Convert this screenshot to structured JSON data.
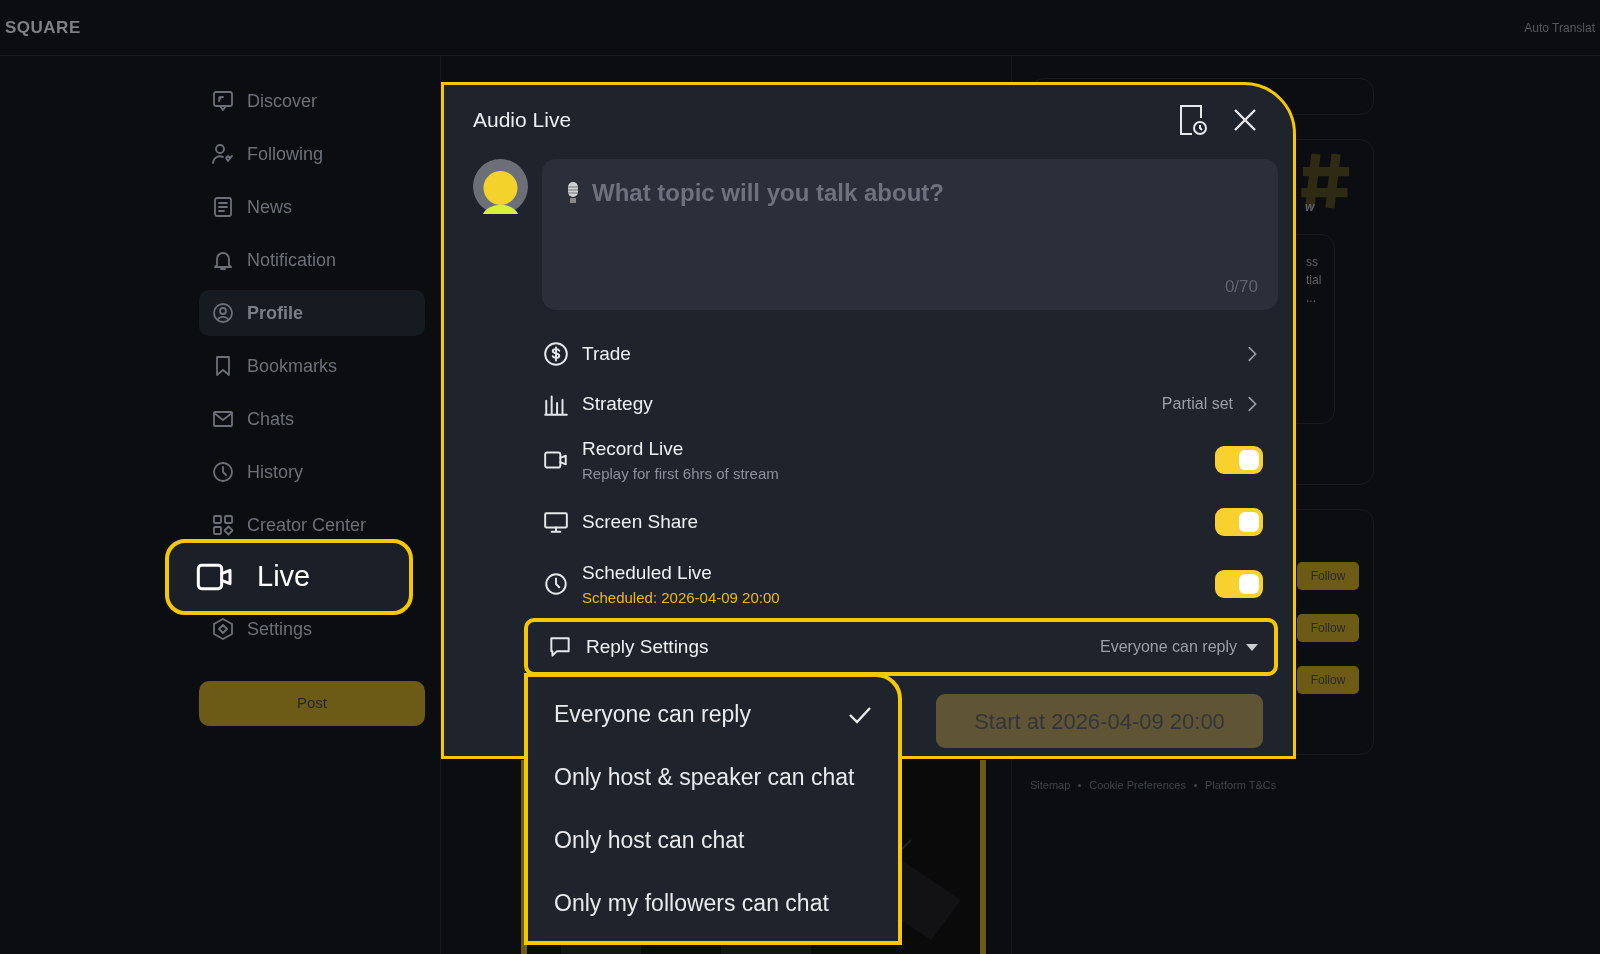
{
  "brand": "SQUARE",
  "top_right": "Auto Translat",
  "sidebar": {
    "items": [
      {
        "label": "Discover",
        "selected": false,
        "highlighted": false
      },
      {
        "label": "Following",
        "selected": false,
        "highlighted": false
      },
      {
        "label": "News",
        "selected": false,
        "highlighted": false
      },
      {
        "label": "Notification",
        "selected": false,
        "highlighted": false
      },
      {
        "label": "Profile",
        "selected": true,
        "highlighted": false
      },
      {
        "label": "Bookmarks",
        "selected": false,
        "highlighted": false
      },
      {
        "label": "Chats",
        "selected": false,
        "highlighted": false
      },
      {
        "label": "History",
        "selected": false,
        "highlighted": false
      },
      {
        "label": "Creator Center",
        "selected": false,
        "highlighted": false
      },
      {
        "label": "Live",
        "selected": false,
        "highlighted": true
      },
      {
        "label": "Settings",
        "selected": false,
        "highlighted": false
      }
    ],
    "post_button": "Post"
  },
  "right_panel": {
    "card_texts": [
      "w",
      "ss",
      "tial",
      "..."
    ],
    "follow_buttons": [
      "Follow",
      "Follow",
      "Follow"
    ],
    "footer_links": [
      "Sitemap",
      "Cookie Preferences",
      "Platform T&Cs"
    ]
  },
  "modal": {
    "title": "Audio Live",
    "topic": {
      "placeholder": "What topic will you talk about?",
      "counter": "0/70"
    },
    "rows": [
      {
        "kind": "link",
        "label": "Trade"
      },
      {
        "kind": "link",
        "label": "Strategy",
        "value": "Partial set"
      },
      {
        "kind": "toggle",
        "label": "Record Live",
        "sub": "Replay for first 6hrs of stream",
        "sub_accent": false,
        "on": true
      },
      {
        "kind": "toggle",
        "label": "Screen Share",
        "on": true
      },
      {
        "kind": "toggle",
        "label": "Scheduled Live",
        "sub": "Scheduled: 2026-04-09 20:00",
        "sub_accent": true,
        "on": true
      },
      {
        "kind": "select",
        "label": "Reply Settings",
        "value": "Everyone can reply",
        "expanded": true,
        "highlighted": true
      }
    ],
    "start_button": "Start at 2026-04-09 20:00",
    "reply_options": [
      {
        "label": "Everyone can reply",
        "selected": true
      },
      {
        "label": "Only host & speaker can chat",
        "selected": false
      },
      {
        "label": "Only host can chat",
        "selected": false
      },
      {
        "label": "Only my followers can chat",
        "selected": false
      }
    ]
  }
}
